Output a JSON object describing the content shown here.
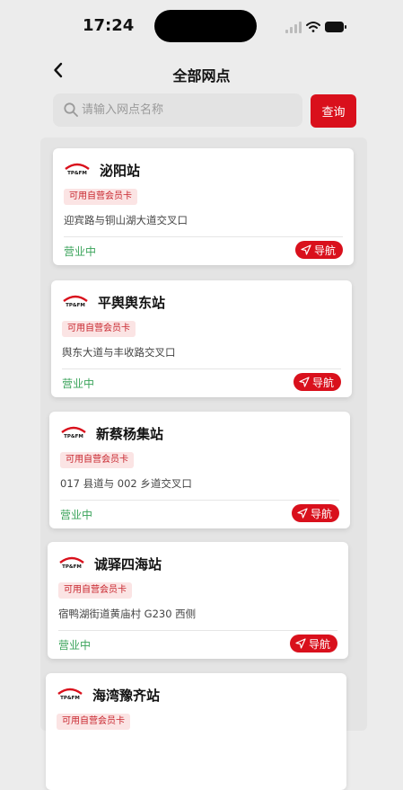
{
  "status_bar": {
    "time": "17:24"
  },
  "header": {
    "title": "全部网点"
  },
  "search": {
    "placeholder": "请输入网点名称",
    "value": "",
    "button_label": "查询"
  },
  "stations": [
    {
      "name": "泌阳站",
      "tag": "可用自营会员卡",
      "address": "迎宾路与铜山湖大道交叉口",
      "status": "营业中",
      "nav_label": "导航"
    },
    {
      "name": "平舆舆东站",
      "tag": "可用自营会员卡",
      "address": "舆东大道与丰收路交叉口",
      "status": "营业中",
      "nav_label": "导航"
    },
    {
      "name": "新蔡杨集站",
      "tag": "可用自营会员卡",
      "address": "017 县道与 002 乡道交叉口",
      "status": "营业中",
      "nav_label": "导航"
    },
    {
      "name": "诚驿四海站",
      "tag": "可用自营会员卡",
      "address": "宿鸭湖街道黄庙村 G230 西侧",
      "status": "营业中",
      "nav_label": "导航"
    },
    {
      "name": "海湾豫齐站",
      "tag": "可用自营会员卡",
      "address": "",
      "status": "",
      "nav_label": ""
    }
  ],
  "colors": {
    "accent": "#d9101c",
    "open_status": "#3aa35a",
    "tag_bg": "#fbe4e4",
    "tag_text": "#c8262e"
  },
  "icons": {
    "back": "chevron-left-icon",
    "search": "magnifier-icon",
    "navigate": "paper-plane-icon",
    "logo": "tp-fm-logo"
  }
}
